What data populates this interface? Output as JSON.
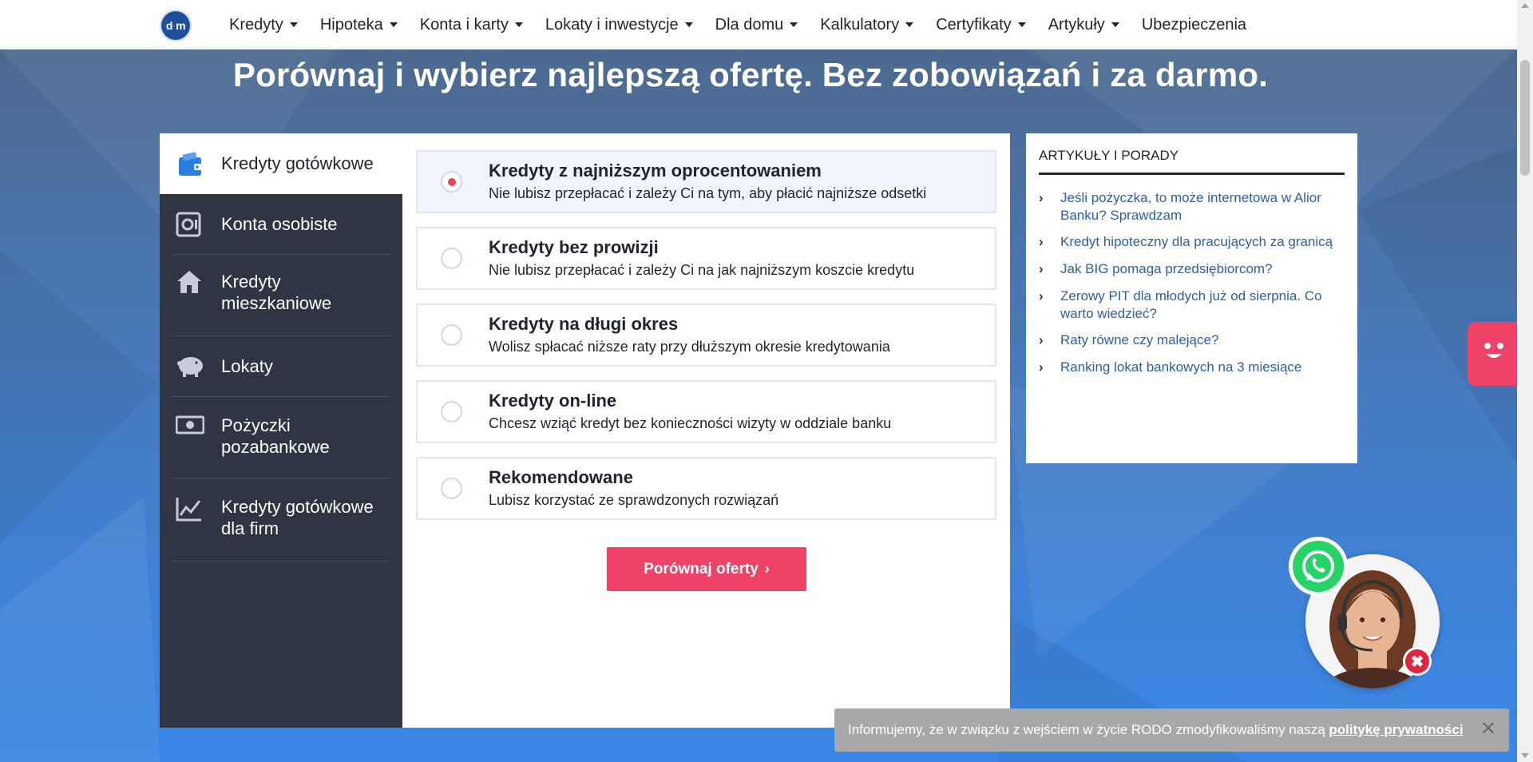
{
  "nav": {
    "logo_text": "dm",
    "items": [
      {
        "label": "Kredyty",
        "dropdown": true
      },
      {
        "label": "Hipoteka",
        "dropdown": true
      },
      {
        "label": "Konta i karty",
        "dropdown": true
      },
      {
        "label": "Lokaty i inwestycje",
        "dropdown": true
      },
      {
        "label": "Dla domu",
        "dropdown": true
      },
      {
        "label": "Kalkulatory",
        "dropdown": true
      },
      {
        "label": "Certyfikaty",
        "dropdown": true
      },
      {
        "label": "Artykuły",
        "dropdown": true
      },
      {
        "label": "Ubezpieczenia",
        "dropdown": false
      }
    ]
  },
  "headline": "Porównaj i wybierz najlepszą ofertę. Bez zobowiązań i za darmo.",
  "sidebar": {
    "active": {
      "label": "Kredyty gotówkowe",
      "icon": "wallet-icon"
    },
    "items": [
      {
        "label": "Konta osobiste",
        "icon": "safe-icon"
      },
      {
        "label": "Kredyty mieszkaniowe",
        "icon": "house-icon"
      },
      {
        "label": "Lokaty",
        "icon": "piggy-bank-icon"
      },
      {
        "label": "Pożyczki pozabankowe",
        "icon": "banknote-icon"
      },
      {
        "label": "Kredyty gotówkowe dla firm",
        "icon": "chart-icon"
      }
    ]
  },
  "options": [
    {
      "title": "Kredyty z najniższym oprocentowaniem",
      "desc": "Nie lubisz przepłacać i zależy Ci na tym, aby płacić najniższe odsetki",
      "selected": true
    },
    {
      "title": "Kredyty bez prowizji",
      "desc": "Nie lubisz przepłacać i zależy Ci na jak najniższym koszcie kredytu",
      "selected": false
    },
    {
      "title": "Kredyty na długi okres",
      "desc": "Wolisz spłacać niższe raty przy dłuższym okresie kredytowania",
      "selected": false
    },
    {
      "title": "Kredyty on-line",
      "desc": "Chcesz wziąć kredyt bez konieczności wizyty w oddziale banku",
      "selected": false
    },
    {
      "title": "Rekomendowane",
      "desc": "Lubisz korzystać ze sprawdzonych rozwiązań",
      "selected": false
    }
  ],
  "cta": {
    "label": "Porównaj oferty",
    "chevron": "›"
  },
  "articles": {
    "heading": "ARTYKUŁY I PORADY",
    "items": [
      "Jeśli pożyczka, to może internetowa w Alior Banku? Sprawdzam",
      "Kredyt hipoteczny dla pracujących za granicą",
      "Jak BIG pomaga przedsiębiorcom?",
      "Zerowy PIT dla młodych już od sierpnia. Co warto wiedzieć?",
      "Raty równe czy malejące?",
      "Ranking lokat bankowych na 3 miesiące"
    ]
  },
  "cookie": {
    "message": "Informujemy, że w związku z wejściem w życie RODO zmodyfikowaliśmy naszą ",
    "link": "politykę prywatności",
    "close": "✕"
  },
  "widgets": {
    "close_consultant": "✖"
  },
  "colors": {
    "accent": "#ee4266",
    "sidebar": "#2f3542",
    "link": "#2e5f9e",
    "whatsapp": "#25d366"
  }
}
